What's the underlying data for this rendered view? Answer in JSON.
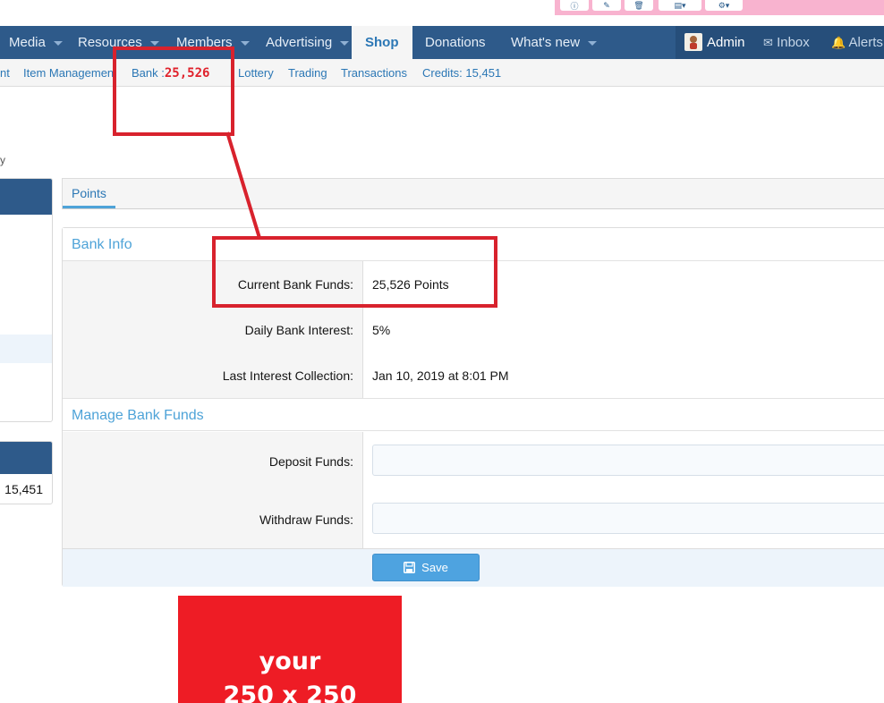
{
  "nav": {
    "tabs": [
      {
        "label": "Media"
      },
      {
        "label": "Resources"
      },
      {
        "label": "Members"
      },
      {
        "label": "Advertising"
      },
      {
        "label": "Shop"
      },
      {
        "label": "Donations"
      },
      {
        "label": "What's new"
      }
    ],
    "user": "Admin",
    "inbox": "Inbox",
    "alerts": "Alerts"
  },
  "subnav": {
    "items": [
      "nt",
      "Item Managemen",
      "Bank :",
      "Lottery",
      "Trading",
      "Transactions",
      "Credits: 15,451"
    ],
    "bank_value": "25,526"
  },
  "sidebar": {
    "fragment_text": "y",
    "credits_value": "15,451"
  },
  "tabs": {
    "points": "Points"
  },
  "bank_info": {
    "title": "Bank Info",
    "rows": [
      {
        "label": "Current Bank Funds:",
        "value": "25,526 Points"
      },
      {
        "label": "Daily Bank Interest:",
        "value": "5%"
      },
      {
        "label": "Last Interest Collection:",
        "value": "Jan 10, 2019 at 8:01 PM"
      }
    ]
  },
  "manage": {
    "title": "Manage Bank Funds",
    "deposit_label": "Deposit Funds:",
    "deposit_value": "",
    "withdraw_label": "Withdraw Funds:",
    "withdraw_value": "",
    "save_label": "Save"
  },
  "ad": {
    "line1": "your",
    "line2": "250 x 250"
  },
  "colors": {
    "nav": "#2e5a8a",
    "accent": "#4ea3d8",
    "annotation": "#d8222d",
    "ad": "#ee1c25"
  }
}
